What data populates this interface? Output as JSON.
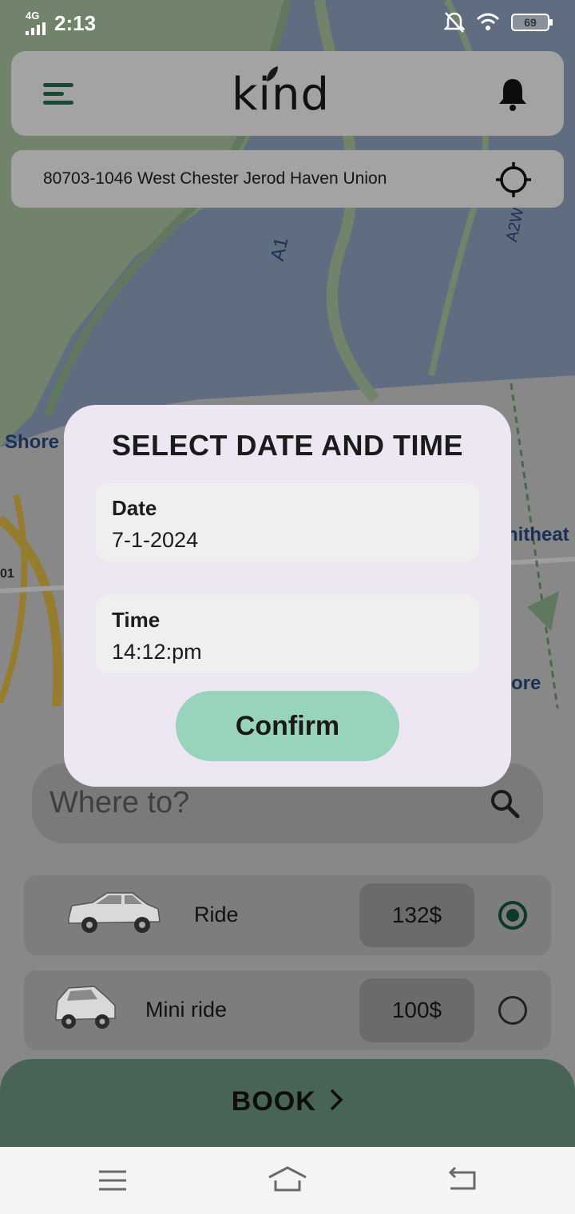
{
  "status_bar": {
    "network": "4G",
    "time": "2:13",
    "battery": "69"
  },
  "header": {
    "logo": "kind"
  },
  "address": {
    "text": "80703-1046 West Chester Jerod Haven Union"
  },
  "map": {
    "labels": [
      "A1",
      "A2W",
      "Shore",
      "nitheat",
      "ore",
      "01"
    ]
  },
  "modal": {
    "title": "SELECT DATE AND TIME",
    "date_label": "Date",
    "date_value": "7-1-2024",
    "time_label": "Time",
    "time_value": "14:12:pm",
    "confirm_label": "Confirm"
  },
  "search": {
    "placeholder": "Where to?"
  },
  "ride_options": [
    {
      "label": "Ride",
      "price": "132$",
      "selected": true
    },
    {
      "label": "Mini ride",
      "price": "100$",
      "selected": false
    }
  ],
  "book": {
    "label": "BOOK"
  },
  "colors": {
    "accent_green": "#98d3bc",
    "book_bar": "#476454",
    "modal_bg": "#ede6f3",
    "radio_selected": "#0c3a26"
  }
}
